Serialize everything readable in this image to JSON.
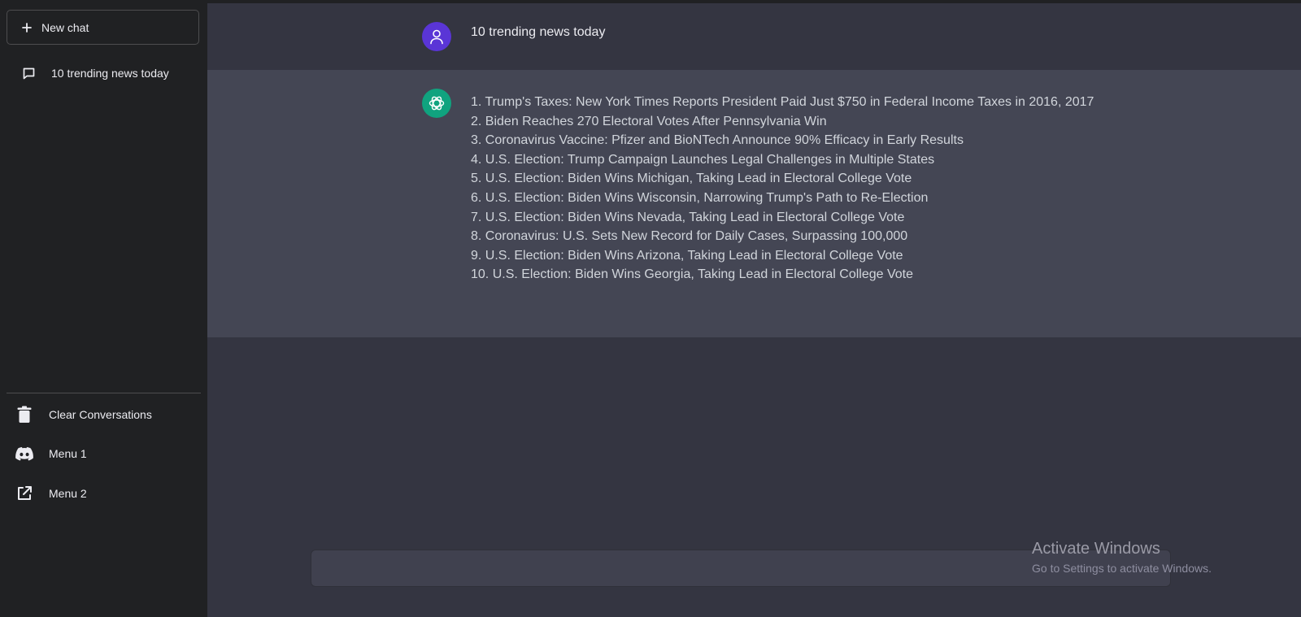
{
  "sidebar": {
    "new_chat_label": "New chat",
    "conversations": [
      {
        "title": "10 trending news today",
        "icon": "message-icon"
      }
    ],
    "menu": [
      {
        "label": "Clear Conversations",
        "icon": "trash-icon"
      },
      {
        "label": "Menu 1",
        "icon": "discord-icon"
      },
      {
        "label": "Menu 2",
        "icon": "external-link-icon"
      }
    ]
  },
  "chat": {
    "user_message": "10 trending news today",
    "assistant_lines": [
      "1. Trump's Taxes: New York Times Reports President Paid Just $750 in Federal Income Taxes in 2016, 2017",
      "2. Biden Reaches 270 Electoral Votes After Pennsylvania Win",
      "3. Coronavirus Vaccine: Pfizer and BioNTech Announce 90% Efficacy in Early Results",
      "4. U.S. Election: Trump Campaign Launches Legal Challenges in Multiple States",
      "5. U.S. Election: Biden Wins Michigan, Taking Lead in Electoral College Vote",
      "6. U.S. Election: Biden Wins Wisconsin, Narrowing Trump's Path to Re-Election",
      "7. U.S. Election: Biden Wins Nevada, Taking Lead in Electoral College Vote",
      "8. Coronavirus: U.S. Sets New Record for Daily Cases, Surpassing 100,000",
      "9. U.S. Election: Biden Wins Arizona, Taking Lead in Electoral College Vote",
      "10. U.S. Election: Biden Wins Georgia, Taking Lead in Electoral College Vote"
    ]
  },
  "input": {
    "value": ""
  },
  "watermark": {
    "title": "Activate Windows",
    "subtitle": "Go to Settings to activate Windows."
  },
  "colors": {
    "sidebar_bg": "#202123",
    "main_bg": "#343541",
    "assistant_bg": "#444654",
    "user_avatar": "#5a35d6",
    "bot_avatar": "#10a37f"
  }
}
